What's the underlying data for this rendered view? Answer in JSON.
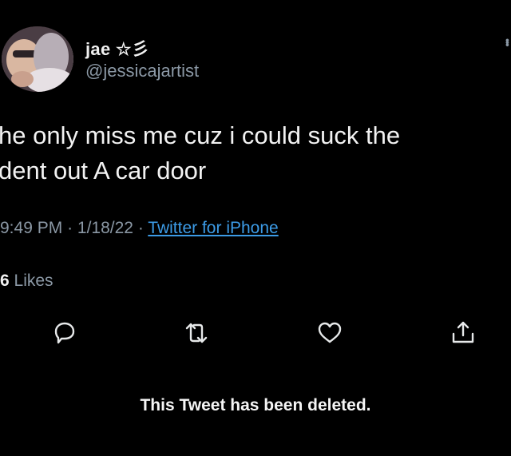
{
  "author": {
    "display_name": "jae ☆彡",
    "handle": "@jessicajartist",
    "avatar_icon": "profile-photo"
  },
  "tweet": {
    "text": "he only miss me cuz i could suck the\ndent out A car door",
    "time": "9:49 PM",
    "date": "1/18/22",
    "separator": "·",
    "source": "Twitter for iPhone",
    "likes_count": "6",
    "likes_label": "Likes"
  },
  "actions": [
    {
      "name": "reply-icon"
    },
    {
      "name": "retweet-icon"
    },
    {
      "name": "like-icon"
    },
    {
      "name": "share-icon"
    }
  ],
  "notice": "This Tweet has been deleted.",
  "colors": {
    "background": "#000000",
    "text": "#e7e9ea",
    "muted": "#8b98a5",
    "link": "#3c9be6"
  }
}
